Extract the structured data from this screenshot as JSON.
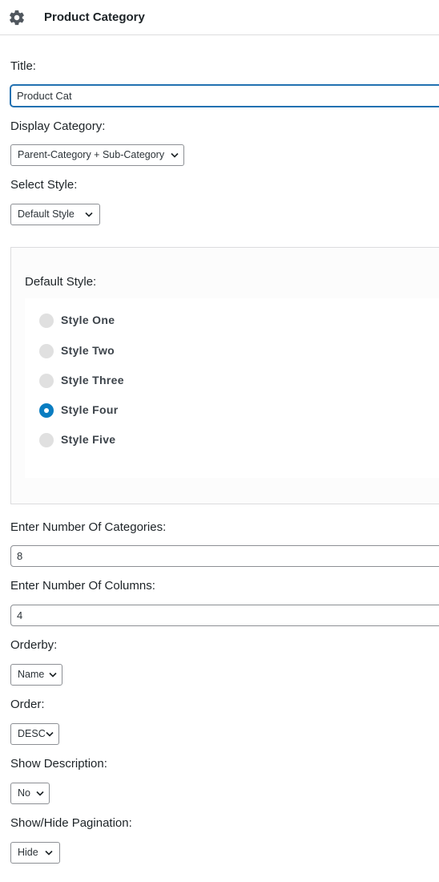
{
  "header": {
    "title": "Product Category",
    "icon": "gear-icon"
  },
  "fields": {
    "title_label": "Title:",
    "title_value": "Product Cat",
    "display_category_label": "Display Category:",
    "display_category_value": "Parent-Category + Sub-Category",
    "select_style_label": "Select Style:",
    "select_style_value": "Default Style",
    "num_categories_label": "Enter Number Of Categories:",
    "num_categories_value": "8",
    "num_columns_label": "Enter Number Of Columns:",
    "num_columns_value": "4",
    "orderby_label": "Orderby:",
    "orderby_value": "Name",
    "order_label": "Order:",
    "order_value": "DESC",
    "show_description_label": "Show Description:",
    "show_description_value": "No",
    "pagination_label": "Show/Hide Pagination:",
    "pagination_value": "Hide"
  },
  "default_style": {
    "label": "Default Style:",
    "options": [
      {
        "label": "Style One",
        "checked": false
      },
      {
        "label": "Style Two",
        "checked": false
      },
      {
        "label": "Style Three",
        "checked": false
      },
      {
        "label": "Style Four",
        "checked": true
      },
      {
        "label": "Style Five",
        "checked": false
      }
    ]
  },
  "colors": {
    "accent": "#0a7dc1",
    "focus_border": "#2271b1",
    "text": "#1d2327"
  }
}
